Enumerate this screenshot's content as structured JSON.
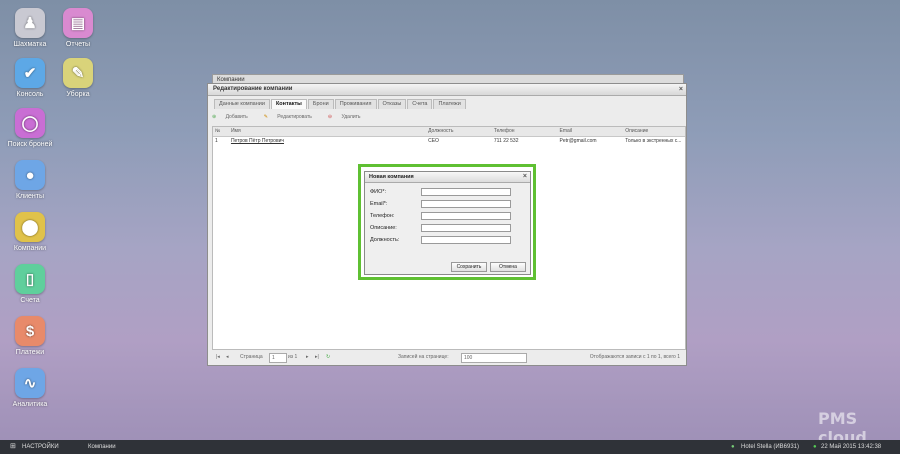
{
  "desktop": {
    "icons": [
      {
        "label": "Шахматка",
        "color": "#c9c9d2",
        "icon": "chess-icon"
      },
      {
        "label": "Отчеты",
        "color": "#d98ad0",
        "icon": "reports-icon"
      },
      {
        "label": "Консоль",
        "color": "#5da8e6",
        "icon": "check-icon"
      },
      {
        "label": "Уборка",
        "color": "#d9d37a",
        "icon": "broom-icon"
      },
      {
        "label": "Поиск броней",
        "color": "#c96ed4",
        "icon": "search-ring-icon"
      },
      {
        "label": "Клиенты",
        "color": "#6ea6e6",
        "icon": "user-icon"
      },
      {
        "label": "Компании",
        "color": "#e0c24a",
        "icon": "map-pin-icon"
      },
      {
        "label": "Счета",
        "color": "#5fcf9c",
        "icon": "document-icon"
      },
      {
        "label": "Платежи",
        "color": "#e88a6a",
        "icon": "dollar-icon"
      },
      {
        "label": "Аналитика",
        "color": "#6ea6e6",
        "icon": "analytics-icon"
      }
    ]
  },
  "back_window": {
    "title": "Компании"
  },
  "window": {
    "title": "Редактирование компании",
    "tabs": [
      "Данные компании",
      "Контакты",
      "Брони",
      "Проживания",
      "Отказы",
      "Счета",
      "Платежи"
    ],
    "toolbar": {
      "add": "Добавить",
      "edit": "Редактировать",
      "delete": "Удалить"
    },
    "grid": {
      "headers": [
        "№",
        "Имя",
        "Должность",
        "Телефон",
        "Email",
        "Описание"
      ],
      "rows": [
        [
          "1",
          "Петров Пётр Петрович",
          "CEO",
          "711 22 532",
          "Petr@gmail.com",
          "Только в экстренных с..."
        ]
      ]
    },
    "pager": {
      "page_label": "Страница",
      "page": "1",
      "of": "из 1",
      "per_page_label": "Записей на странице:",
      "per_page": "100",
      "info": "Отображаются записи с 1 по 1, всего 1"
    }
  },
  "modal": {
    "title": "Новая компания",
    "fields": [
      {
        "label": "ФИО*:",
        "required": true
      },
      {
        "label": "Email*:",
        "required": true
      },
      {
        "label": "Телефон:",
        "required": false
      },
      {
        "label": "Описание:",
        "required": false
      },
      {
        "label": "Должность:",
        "required": false
      }
    ],
    "save": "Сохранить",
    "cancel": "Отмена"
  },
  "taskbar": {
    "settings": "НАСТРОЙКИ",
    "active": "Компании",
    "hotel": "Hotel Stella (ИВ6931)",
    "datetime": "22 Май 2015 13:42:38"
  },
  "watermark": "PMS cloud"
}
